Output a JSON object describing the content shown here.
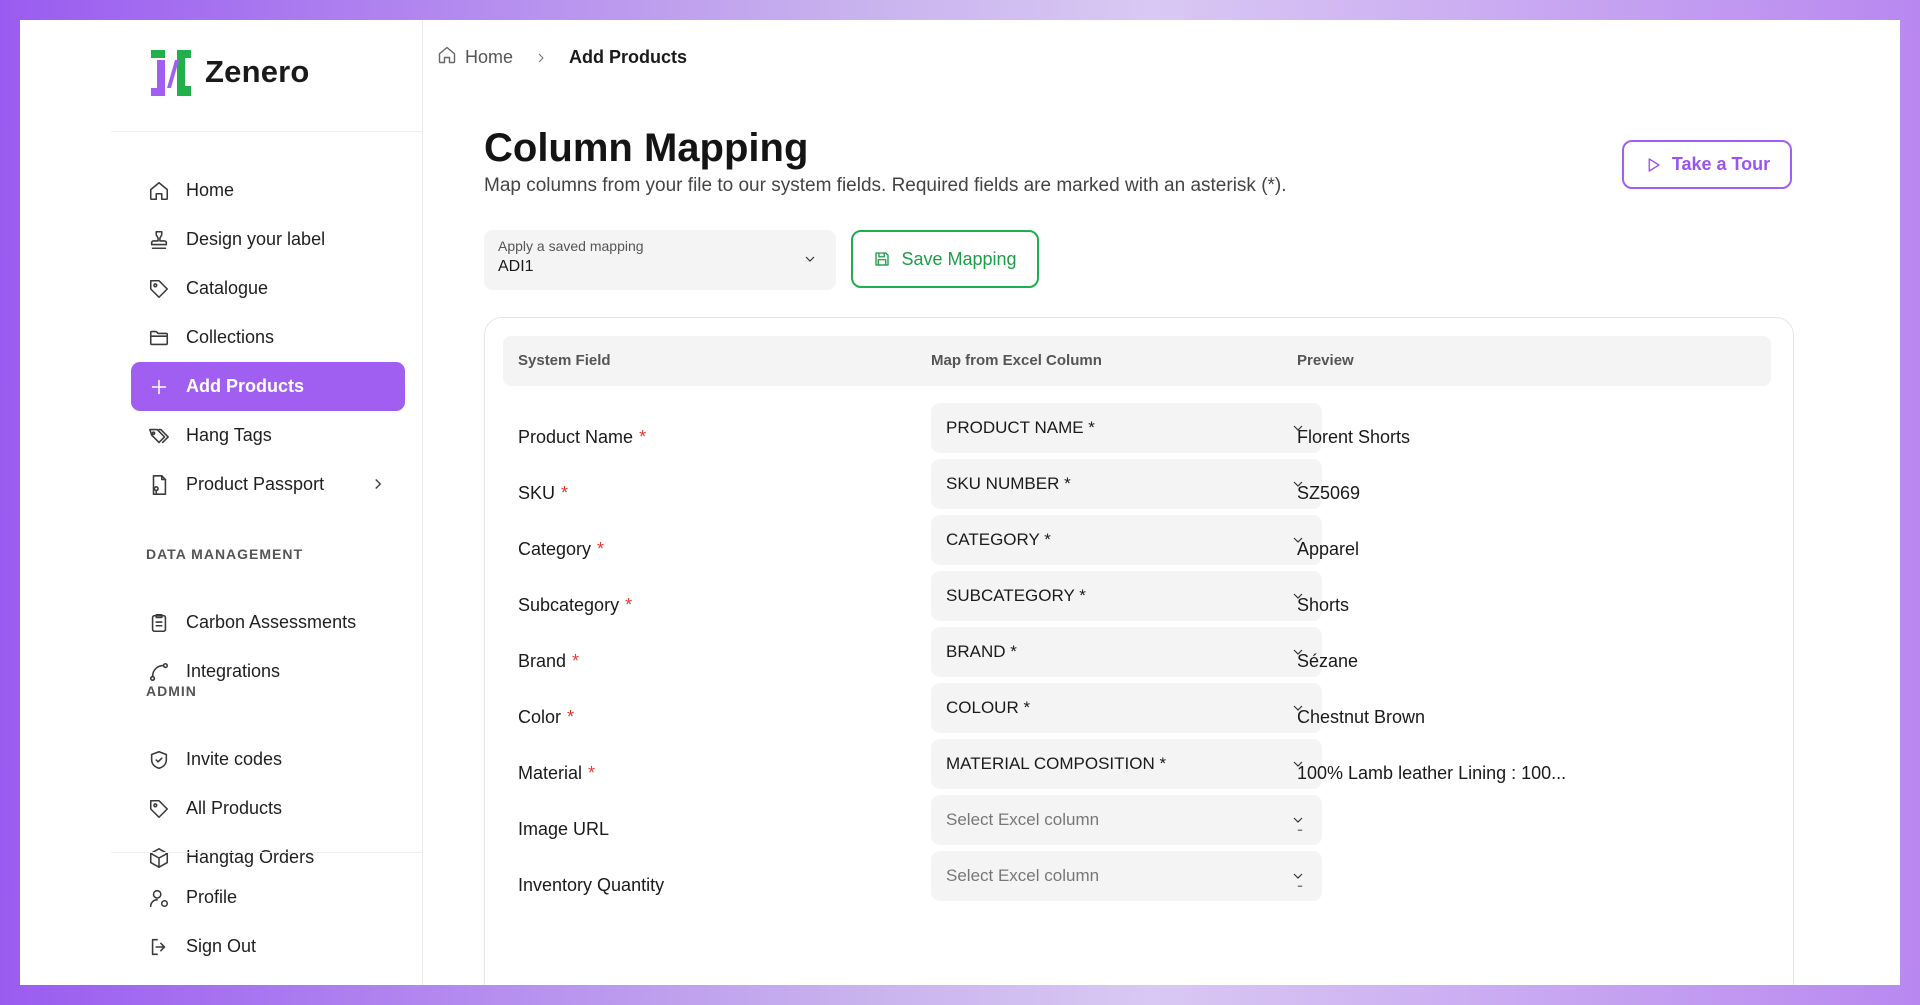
{
  "brand": {
    "name": "Zenero",
    "accent": "#a15ff2",
    "green": "#1fae4e"
  },
  "sidebar": {
    "main_items": [
      {
        "label": "Home",
        "icon": "home-icon"
      },
      {
        "label": "Design your label",
        "icon": "stamp-icon"
      },
      {
        "label": "Catalogue",
        "icon": "tag-icon"
      },
      {
        "label": "Collections",
        "icon": "folder-icon"
      },
      {
        "label": "Add Products",
        "icon": "plus-icon",
        "active": true
      },
      {
        "label": "Hang Tags",
        "icon": "tags-icon"
      },
      {
        "label": "Product Passport",
        "icon": "passport-icon"
      }
    ],
    "data_management_label": "DATA MANAGEMENT",
    "data_items": [
      {
        "label": "Carbon Assessments",
        "icon": "clipboard-icon"
      },
      {
        "label": "Integrations",
        "icon": "route-icon"
      }
    ],
    "admin_label": "ADMIN",
    "admin_items": [
      {
        "label": "Invite codes",
        "icon": "shield-check-icon"
      },
      {
        "label": "All Products",
        "icon": "tag-icon"
      },
      {
        "label": "Hangtag Orders",
        "icon": "package-icon"
      }
    ],
    "bottom_items": [
      {
        "label": "Profile",
        "icon": "user-icon"
      },
      {
        "label": "Sign Out",
        "icon": "sign-out-icon"
      }
    ]
  },
  "breadcrumb": {
    "home": "Home",
    "current": "Add Products"
  },
  "header": {
    "title": "Column Mapping",
    "subtitle": "Map columns from your file to our system fields. Required fields are marked with an asterisk (*).",
    "tour_label": "Take a Tour"
  },
  "saved_mapping": {
    "label": "Apply a saved mapping",
    "value": "ADI1"
  },
  "save_mapping_label": "Save Mapping",
  "table": {
    "headers": {
      "system_field": "System Field",
      "map_from": "Map from Excel Column",
      "preview": "Preview"
    },
    "rows": [
      {
        "field": "Product Name",
        "required": "*",
        "column": "PRODUCT NAME *",
        "preview": "Florent Shorts"
      },
      {
        "field": "SKU",
        "required": "*",
        "column": "SKU NUMBER *",
        "preview": "SZ5069"
      },
      {
        "field": "Category",
        "required": "*",
        "column": "CATEGORY *",
        "preview": "Apparel"
      },
      {
        "field": "Subcategory",
        "required": "*",
        "column": "SUBCATEGORY *",
        "preview": "Shorts"
      },
      {
        "field": "Brand",
        "required": "*",
        "column": "BRAND *",
        "preview": "Sézane"
      },
      {
        "field": "Color",
        "required": "*",
        "column": "COLOUR *",
        "preview": "Chestnut Brown"
      },
      {
        "field": "Material",
        "required": "*",
        "column": "MATERIAL COMPOSITION *",
        "preview": "100% Lamb leather Lining : 100..."
      },
      {
        "field": "Image URL",
        "required": "",
        "column": "Select Excel column",
        "placeholder": true,
        "preview": "-"
      },
      {
        "field": "Inventory Quantity",
        "required": "",
        "column": "Select Excel column",
        "placeholder": true,
        "preview": "-"
      }
    ]
  }
}
